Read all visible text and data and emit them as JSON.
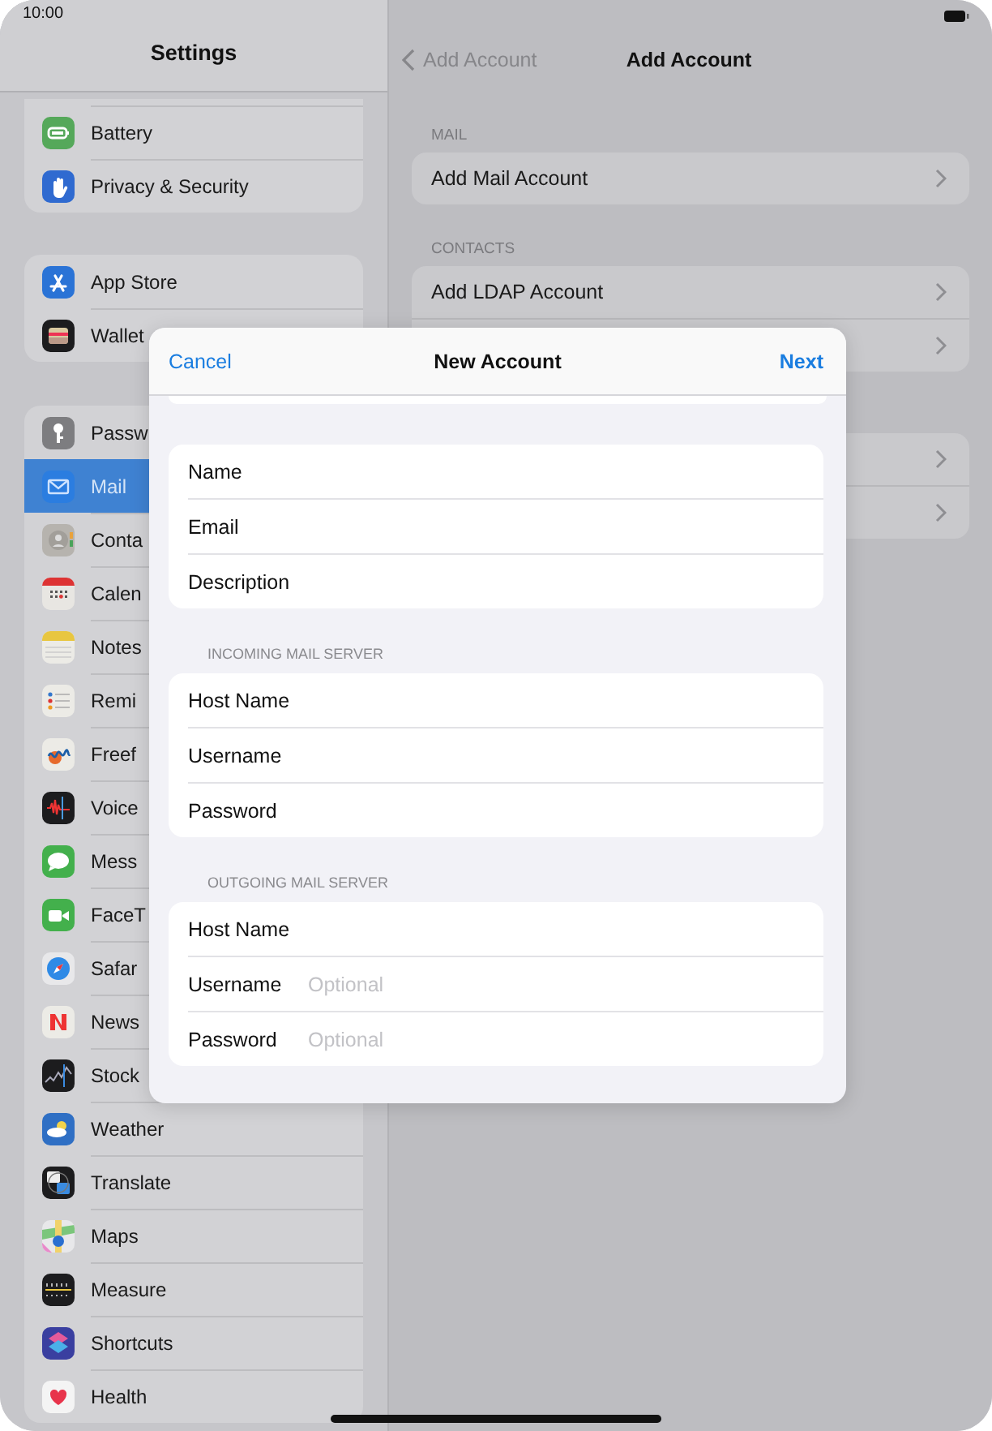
{
  "status_bar": {
    "time": "10:00"
  },
  "sidebar": {
    "title": "Settings",
    "groups": [
      {
        "items": [
          {
            "label": "Battery",
            "selected": false
          },
          {
            "label": "Privacy & Security",
            "selected": false
          }
        ]
      },
      {
        "items": [
          {
            "label": "App Store",
            "selected": false
          },
          {
            "label": "Wallet",
            "selected": false
          }
        ]
      },
      {
        "items": [
          {
            "label": "Passw",
            "selected": false
          },
          {
            "label": "Mail",
            "selected": true
          },
          {
            "label": "Conta",
            "selected": false
          },
          {
            "label": "Calen",
            "selected": false
          },
          {
            "label": "Notes",
            "selected": false
          },
          {
            "label": "Remi",
            "selected": false
          },
          {
            "label": "Freef",
            "selected": false
          },
          {
            "label": "Voice",
            "selected": false
          },
          {
            "label": "Mess",
            "selected": false
          },
          {
            "label": "FaceT",
            "selected": false
          },
          {
            "label": "Safar",
            "selected": false
          },
          {
            "label": "News",
            "selected": false
          },
          {
            "label": "Stock",
            "selected": false
          },
          {
            "label": "Weather",
            "selected": false
          },
          {
            "label": "Translate",
            "selected": false
          },
          {
            "label": "Maps",
            "selected": false
          },
          {
            "label": "Measure",
            "selected": false
          },
          {
            "label": "Shortcuts",
            "selected": false
          },
          {
            "label": "Health",
            "selected": false
          }
        ]
      }
    ]
  },
  "detail": {
    "back": "Add Account",
    "title": "Add Account",
    "sections": [
      {
        "header": "MAIL",
        "rows": [
          {
            "label": "Add Mail Account"
          }
        ]
      },
      {
        "header": "CONTACTS",
        "rows": [
          {
            "label": "Add LDAP Account"
          },
          {}
        ]
      },
      {
        "rows": [
          {},
          {}
        ]
      }
    ]
  },
  "sheet": {
    "cancel": "Cancel",
    "title": "New Account",
    "next": "Next",
    "groups": [
      {
        "fields": [
          {
            "label": "Name"
          },
          {
            "label": "Email"
          },
          {
            "label": "Description"
          }
        ]
      },
      {
        "header": "INCOMING MAIL SERVER",
        "fields": [
          {
            "label": "Host Name"
          },
          {
            "label": "Username"
          },
          {
            "label": "Password"
          }
        ]
      },
      {
        "header": "OUTGOING MAIL SERVER",
        "fields": [
          {
            "label": "Host Name"
          },
          {
            "label": "Username",
            "placeholder": "Optional"
          },
          {
            "label": "Password",
            "placeholder": "Optional"
          }
        ]
      }
    ]
  }
}
